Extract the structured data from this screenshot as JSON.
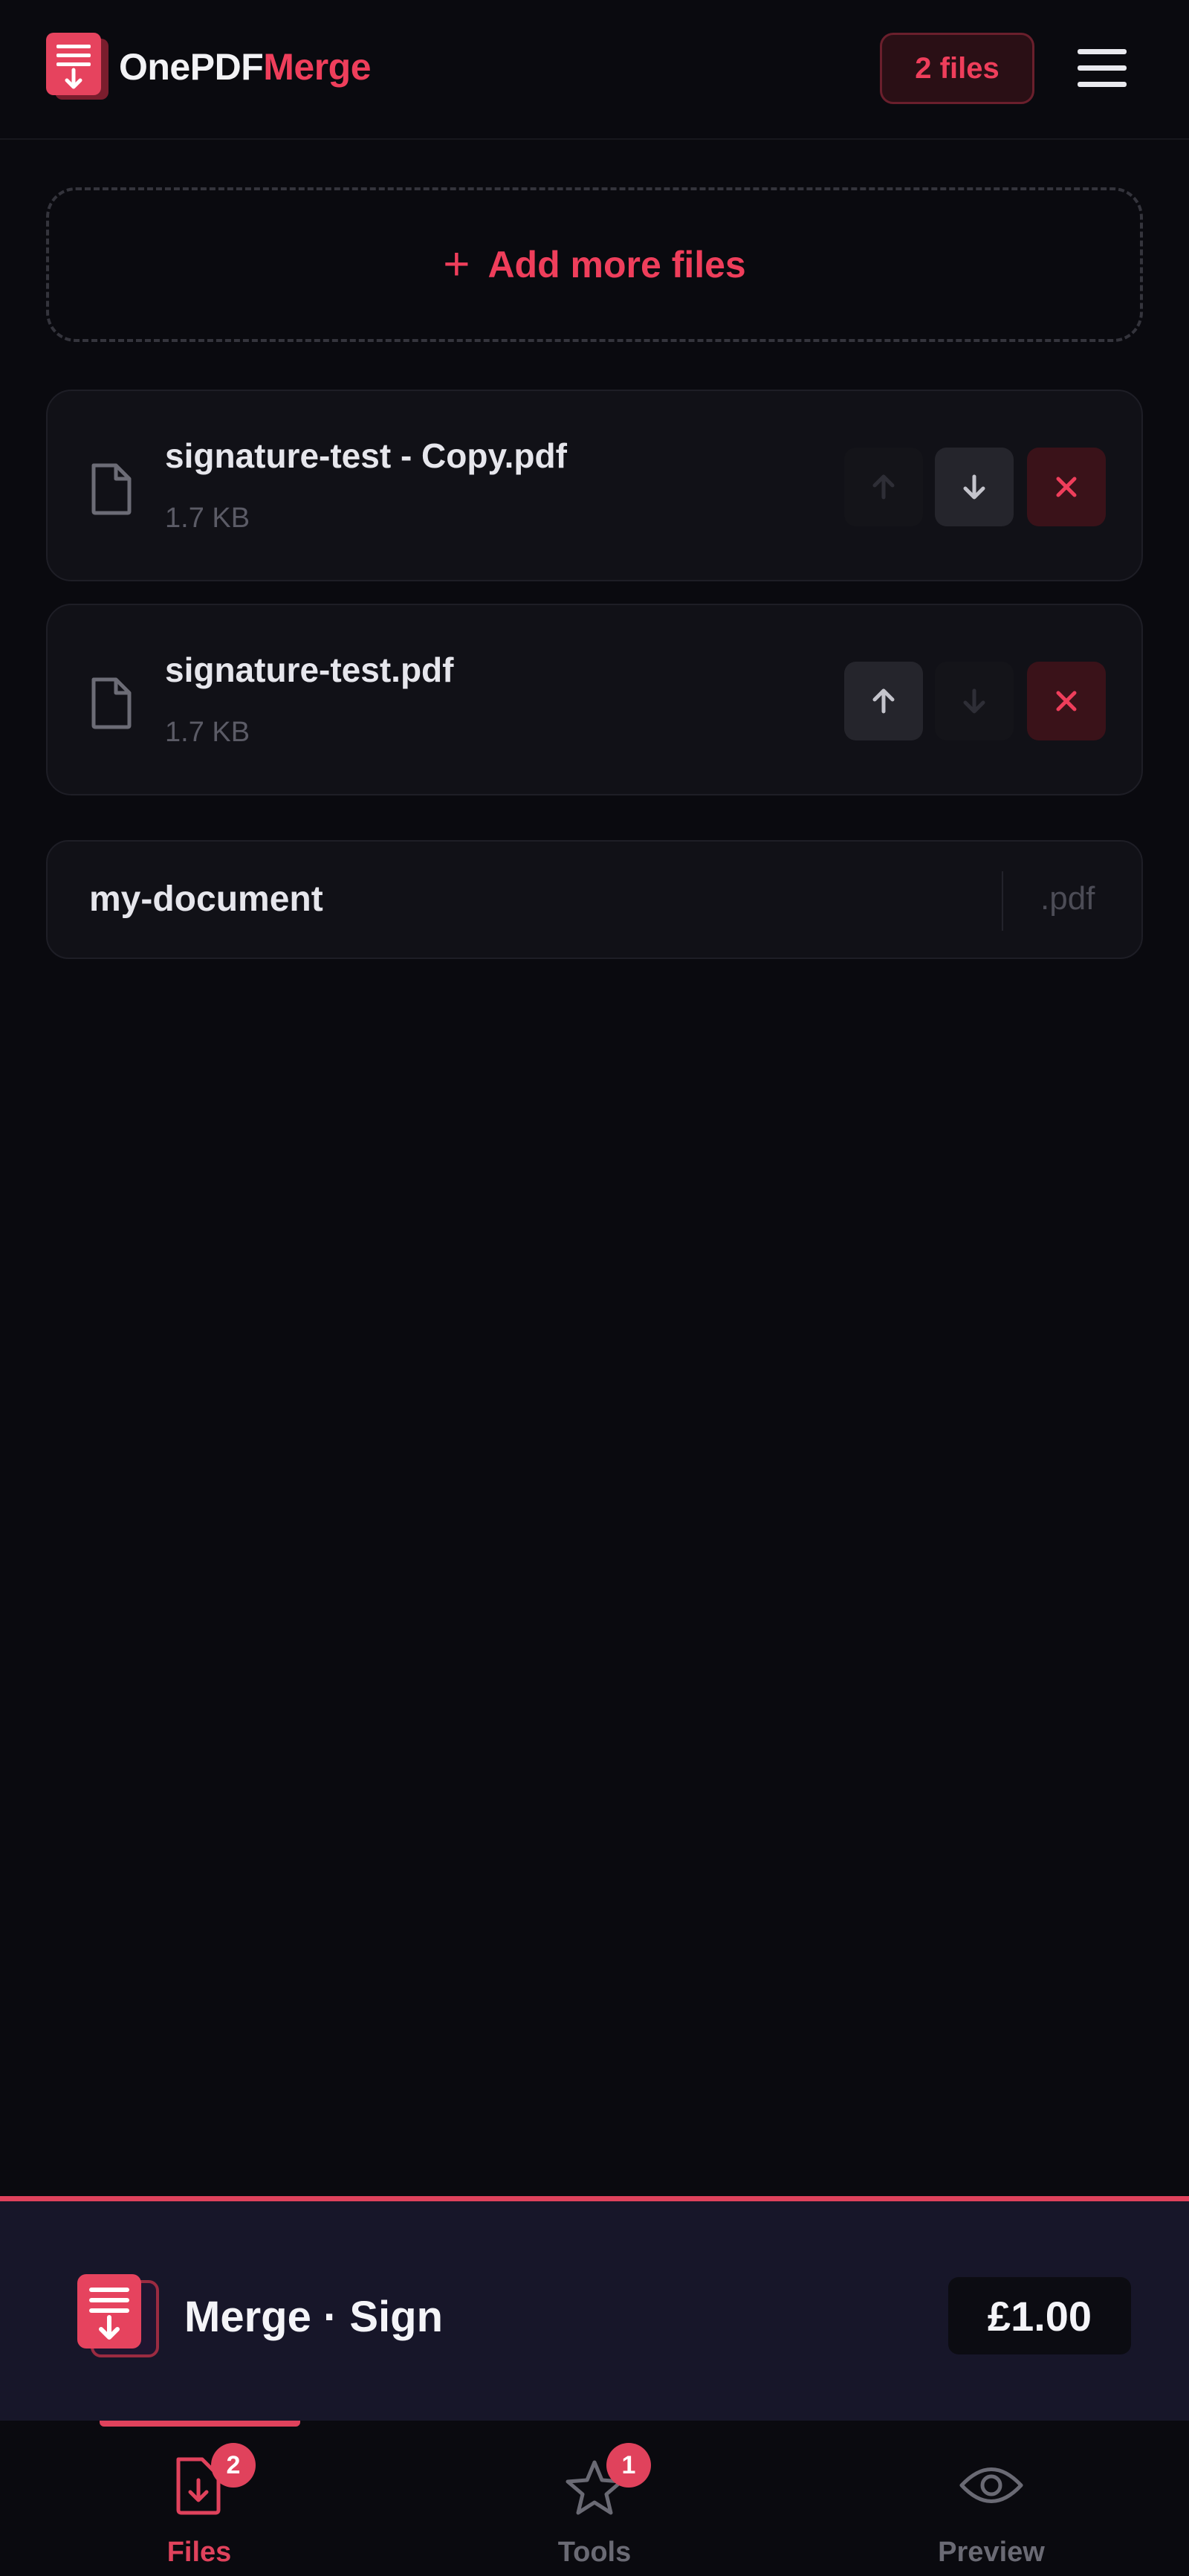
{
  "header": {
    "brand_part1": "OnePDF",
    "brand_part2": "Merge",
    "files_count_badge": "2 files"
  },
  "add_files": {
    "label": "Add more files"
  },
  "files": [
    {
      "name": "signature-test - Copy.pdf",
      "size": "1.7 KB"
    },
    {
      "name": "signature-test.pdf",
      "size": "1.7 KB"
    }
  ],
  "output": {
    "filename": "my-document",
    "extension": ".pdf"
  },
  "action_bar": {
    "title": "Merge · Sign",
    "price": "£1.00"
  },
  "nav": {
    "items": [
      {
        "label": "Files",
        "badge": "2",
        "icon": "file-download-icon",
        "active": true
      },
      {
        "label": "Tools",
        "badge": "1",
        "icon": "star-icon",
        "active": false
      },
      {
        "label": "Preview",
        "badge": "",
        "icon": "eye-icon",
        "active": false
      }
    ]
  },
  "colors": {
    "accent": "#e0425c",
    "background": "#0a0a0f",
    "card": "#111117",
    "action_bar": "#171629"
  }
}
